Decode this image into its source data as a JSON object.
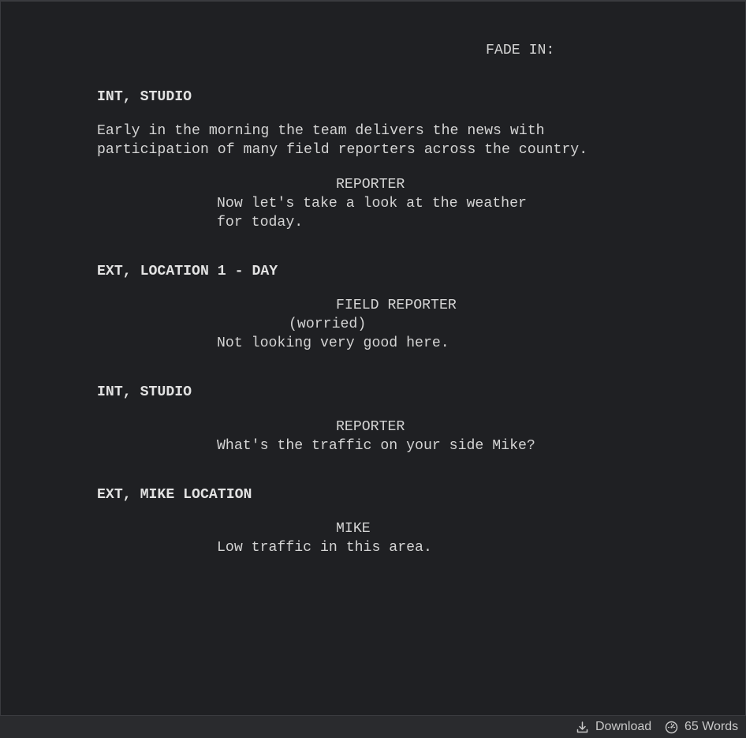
{
  "screenplay": {
    "transition": "FADE IN:",
    "scene1_heading": "INT, STUDIO",
    "scene1_action_line1": "Early in the morning the team delivers the news with",
    "scene1_action_line2": "participation of many field reporters across the country.",
    "scene1_character": "REPORTER",
    "scene1_dialogue_line1": "Now let's take a look at the weather",
    "scene1_dialogue_line2": "for today.",
    "scene2_heading": "EXT, LOCATION 1 - DAY",
    "scene2_character": "FIELD REPORTER",
    "scene2_parenthetical": "(worried)",
    "scene2_dialogue": "Not looking very good here.",
    "scene3_heading": "INT, STUDIO",
    "scene3_character": "REPORTER",
    "scene3_dialogue": "What's the traffic on your side Mike?",
    "scene4_heading": "EXT, MIKE LOCATION",
    "scene4_character": "MIKE",
    "scene4_dialogue": "Low traffic in this area."
  },
  "statusbar": {
    "download_label": "Download",
    "download_icon": "download-icon",
    "word_count_label": "65 Words",
    "word_count_icon": "gauge-icon"
  }
}
